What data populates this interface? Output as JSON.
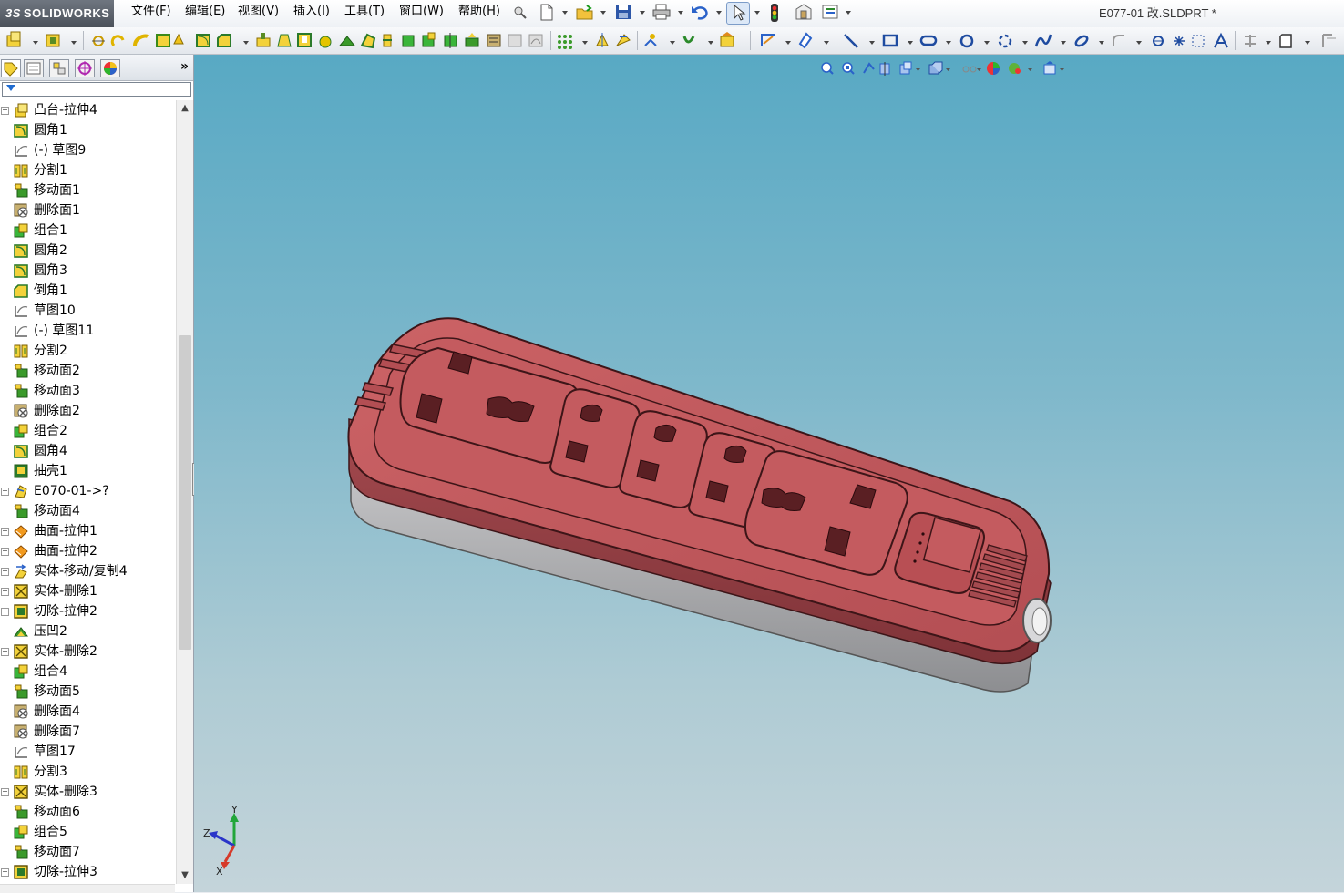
{
  "app": {
    "logo_prefix": "3S",
    "logo_text": "SOLIDWORKS",
    "document_title": "E077-01 改.SLDPRT *"
  },
  "menu": [
    {
      "label": "文件(F)"
    },
    {
      "label": "编辑(E)"
    },
    {
      "label": "视图(V)"
    },
    {
      "label": "插入(I)"
    },
    {
      "label": "工具(T)"
    },
    {
      "label": "窗口(W)"
    },
    {
      "label": "帮助(H)"
    }
  ],
  "panel": {
    "more_glyph": "»",
    "tabs": [
      "feature-manager-tab",
      "property-manager-tab",
      "configuration-manager-tab",
      "dimxpert-tab",
      "display-manager-tab"
    ]
  },
  "feature_tree": [
    {
      "label": "凸台-拉伸4",
      "icon": "boss-extrude",
      "expandable": true
    },
    {
      "label": "圆角1",
      "icon": "fillet",
      "expandable": false
    },
    {
      "label": "(-) 草图9",
      "icon": "sketch",
      "expandable": false
    },
    {
      "label": "分割1",
      "icon": "split",
      "expandable": false
    },
    {
      "label": "移动面1",
      "icon": "move-face",
      "expandable": false
    },
    {
      "label": "删除面1",
      "icon": "delete-face",
      "expandable": false
    },
    {
      "label": "组合1",
      "icon": "combine",
      "expandable": false
    },
    {
      "label": "圆角2",
      "icon": "fillet",
      "expandable": false
    },
    {
      "label": "圆角3",
      "icon": "fillet",
      "expandable": false
    },
    {
      "label": "倒角1",
      "icon": "chamfer",
      "expandable": false
    },
    {
      "label": "草图10",
      "icon": "sketch",
      "expandable": false
    },
    {
      "label": "(-) 草图11",
      "icon": "sketch",
      "expandable": false
    },
    {
      "label": "分割2",
      "icon": "split",
      "expandable": false
    },
    {
      "label": "移动面2",
      "icon": "move-face",
      "expandable": false
    },
    {
      "label": "移动面3",
      "icon": "move-face",
      "expandable": false
    },
    {
      "label": "删除面2",
      "icon": "delete-face",
      "expandable": false
    },
    {
      "label": "组合2",
      "icon": "combine",
      "expandable": false
    },
    {
      "label": "圆角4",
      "icon": "fillet",
      "expandable": false
    },
    {
      "label": "抽壳1",
      "icon": "shell",
      "expandable": false
    },
    {
      "label": "E070-01->?",
      "icon": "derived-part",
      "expandable": true
    },
    {
      "label": "移动面4",
      "icon": "move-face",
      "expandable": false
    },
    {
      "label": "曲面-拉伸1",
      "icon": "surface-extrude",
      "expandable": true
    },
    {
      "label": "曲面-拉伸2",
      "icon": "surface-extrude",
      "expandable": true
    },
    {
      "label": "实体-移动/复制4",
      "icon": "move-copy-body",
      "expandable": true
    },
    {
      "label": "实体-删除1",
      "icon": "delete-body",
      "expandable": true
    },
    {
      "label": "切除-拉伸2",
      "icon": "cut-extrude",
      "expandable": true
    },
    {
      "label": "压凹2",
      "icon": "indent",
      "expandable": false
    },
    {
      "label": "实体-删除2",
      "icon": "delete-body",
      "expandable": true
    },
    {
      "label": "组合4",
      "icon": "combine",
      "expandable": false
    },
    {
      "label": "移动面5",
      "icon": "move-face",
      "expandable": false
    },
    {
      "label": "删除面4",
      "icon": "delete-face",
      "expandable": false
    },
    {
      "label": "删除面7",
      "icon": "delete-face",
      "expandable": false
    },
    {
      "label": "草图17",
      "icon": "sketch",
      "expandable": false
    },
    {
      "label": "分割3",
      "icon": "split",
      "expandable": false
    },
    {
      "label": "实体-删除3",
      "icon": "delete-body",
      "expandable": true
    },
    {
      "label": "移动面6",
      "icon": "move-face",
      "expandable": false
    },
    {
      "label": "组合5",
      "icon": "combine",
      "expandable": false
    },
    {
      "label": "移动面7",
      "icon": "move-face",
      "expandable": false
    },
    {
      "label": "切除-拉伸3",
      "icon": "cut-extrude",
      "expandable": true
    }
  ],
  "triad": {
    "y": "Y",
    "z": "Z",
    "x": "X"
  },
  "colors": {
    "model_top": "#c2595c",
    "model_side": "#8f3c41",
    "model_base": "#a9a9ab",
    "viewport_top": "#58a9c4",
    "viewport_bottom": "#c4d4da"
  }
}
